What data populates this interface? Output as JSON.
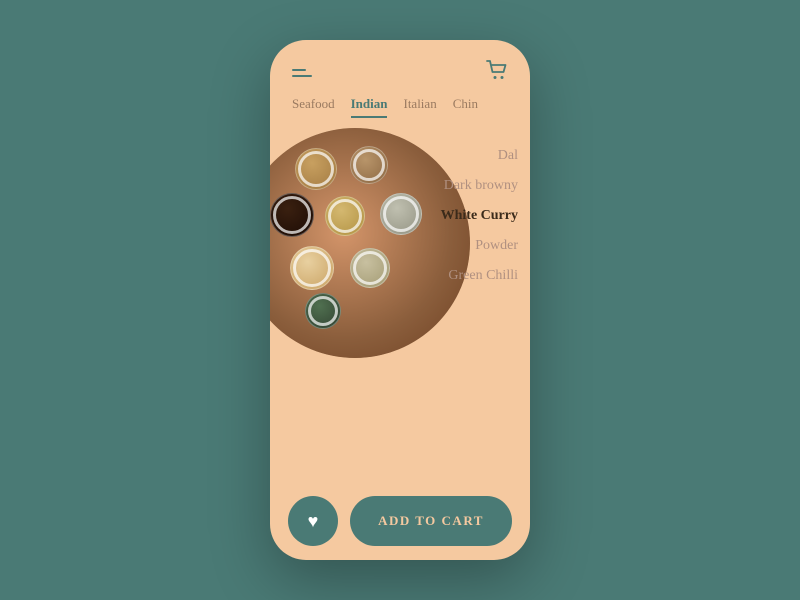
{
  "background": {
    "color": "#4a7a75"
  },
  "phone": {
    "bg_color": "#f5c9a0"
  },
  "header": {
    "cart_label": "cart"
  },
  "nav": {
    "tabs": [
      {
        "id": "seafood",
        "label": "Seafood",
        "active": false
      },
      {
        "id": "indian",
        "label": "Indian",
        "active": true
      },
      {
        "id": "italian",
        "label": "Italian",
        "active": false
      },
      {
        "id": "chinese",
        "label": "Chin",
        "active": false
      }
    ]
  },
  "menu_items": [
    {
      "id": "dal",
      "label": "Dal",
      "active": false
    },
    {
      "id": "dark-browny",
      "label": "Dark browny",
      "active": false
    },
    {
      "id": "white-curry",
      "label": "White Curry",
      "active": true
    },
    {
      "id": "powder",
      "label": "Powder",
      "active": false
    },
    {
      "id": "green-chilli",
      "label": "Green Chilli",
      "active": false
    }
  ],
  "bottom": {
    "add_to_cart_label": "ADD TO CART",
    "favorite_icon": "♥"
  }
}
